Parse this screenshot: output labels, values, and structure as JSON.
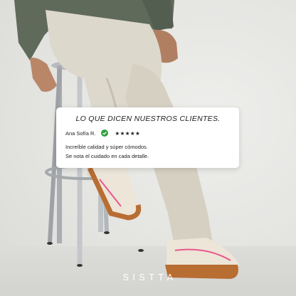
{
  "testimonial": {
    "title": "LO QUE DICEN NUESTROS CLIENTES.",
    "reviewer": "Ana Sofía R.",
    "rating": 5,
    "stars": "★★★★★",
    "lines": [
      "Increíble calidad y súper cómodos.",
      "Se nota el cuidado en cada detalle."
    ],
    "verified_icon": "check-circle-icon",
    "verified_color": "#2f9e3f"
  },
  "brand": {
    "name": "SISTTA"
  },
  "colors": {
    "sole": "#b86d33",
    "accent_stitch": "#e9578f",
    "sneaker_upper": "#ece5d8",
    "pants": "#ddd8cc",
    "sweater": "#5f6a5b"
  }
}
